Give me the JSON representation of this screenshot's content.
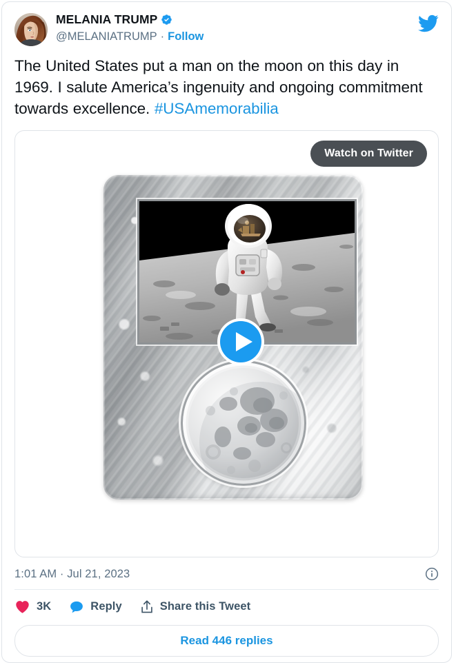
{
  "tweet": {
    "author": {
      "display_name": "MELANIA TRUMP",
      "handle": "@MELANIATRUMP",
      "verified_badge": "verified-check-icon",
      "avatar": "profile-photo",
      "separator": "·",
      "follow_label": "Follow"
    },
    "brand_logo": "twitter-bird-icon",
    "text": {
      "body": "The United States put a man on the moon on this day in 1969.  I salute America’s ingenuity and ongoing commitment towards excellence.  ",
      "hashtag": "#USAmemorabilia"
    },
    "media": {
      "watch_button_label": "Watch on Twitter",
      "play_button": "play-icon",
      "plaque_photo_alt": "astronaut-on-moon-photo",
      "plaque_medallion_alt": "moon-relief-medallion"
    },
    "meta": {
      "time": "1:01 AM",
      "separator": "·",
      "date": "Jul 21, 2023",
      "timestamp_full": "1:01 AM · Jul 21, 2023",
      "info_icon": "info-circle-icon"
    },
    "actions": {
      "like": {
        "icon": "heart-icon",
        "count": "3K"
      },
      "reply": {
        "icon": "speech-bubble-icon",
        "label": "Reply"
      },
      "share": {
        "icon": "share-arrow-icon",
        "label": "Share this Tweet"
      }
    },
    "read_replies_label": "Read 446 replies"
  },
  "colors": {
    "twitter_blue": "#1b95e0",
    "link_blue": "#1b95e0",
    "like_pink": "#e8245a",
    "reply_blue": "#1b95e0",
    "text_primary": "#0f1419",
    "text_secondary": "#5b7083",
    "action_label": "#3d5466",
    "border": "#dfe3e8",
    "watch_button_bg": "#4a4f54"
  }
}
